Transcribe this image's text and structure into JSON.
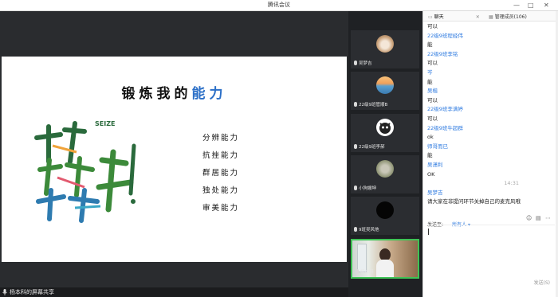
{
  "window": {
    "title": "腾讯会议",
    "minimize": "—",
    "maximize": "□",
    "close": "✕"
  },
  "slide": {
    "title_prefix": "锻炼我的",
    "title_highlight": "能力",
    "abilities": [
      "分辨能力",
      "抗挫能力",
      "群居能力",
      "独处能力",
      "审美能力"
    ]
  },
  "status": {
    "share_text": "杨本科的屏幕共享"
  },
  "participants": [
    {
      "name": "吴梦吉",
      "avatar": "cat-photo"
    },
    {
      "name": "22级9班管顺B",
      "avatar": "sunset-photo"
    },
    {
      "name": "22级9班李郝",
      "avatar": "cartoon-avatar"
    },
    {
      "name": "小狗嫂坤",
      "avatar": "pet-photo"
    },
    {
      "name": "9班吴风他",
      "avatar": "black-avatar"
    },
    {
      "name": "杨本科",
      "avatar": "camera-video"
    }
  ],
  "chat": {
    "tab_chat": "聊天",
    "tab_members": "管理成员(106)",
    "messages": [
      {
        "type": "text",
        "value": "可以"
      },
      {
        "type": "name",
        "value": "22级9班程经伟"
      },
      {
        "type": "text",
        "value": "能"
      },
      {
        "type": "name",
        "value": "22级9班李铭"
      },
      {
        "type": "text",
        "value": "可以"
      },
      {
        "type": "name",
        "value": "岑"
      },
      {
        "type": "text",
        "value": "能"
      },
      {
        "type": "name",
        "value": "吴楷"
      },
      {
        "type": "text",
        "value": "可以"
      },
      {
        "type": "name",
        "value": "22级9班李满婷"
      },
      {
        "type": "text",
        "value": "可以"
      },
      {
        "type": "name",
        "value": "22级9班牛超群"
      },
      {
        "type": "text",
        "value": "ok"
      },
      {
        "type": "name",
        "value": "师哥而已"
      },
      {
        "type": "text",
        "value": "能"
      },
      {
        "type": "name",
        "value": "吴潇利"
      },
      {
        "type": "text",
        "value": "OK"
      },
      {
        "type": "time",
        "value": "14:31"
      },
      {
        "type": "name",
        "value": "吴梦吉"
      },
      {
        "type": "text",
        "value": "请大家在非提问环节关掉自己的麦克风哦"
      }
    ],
    "send_to_label": "发送至:",
    "send_to_value": "所有人",
    "send_button": "发送(S)"
  }
}
